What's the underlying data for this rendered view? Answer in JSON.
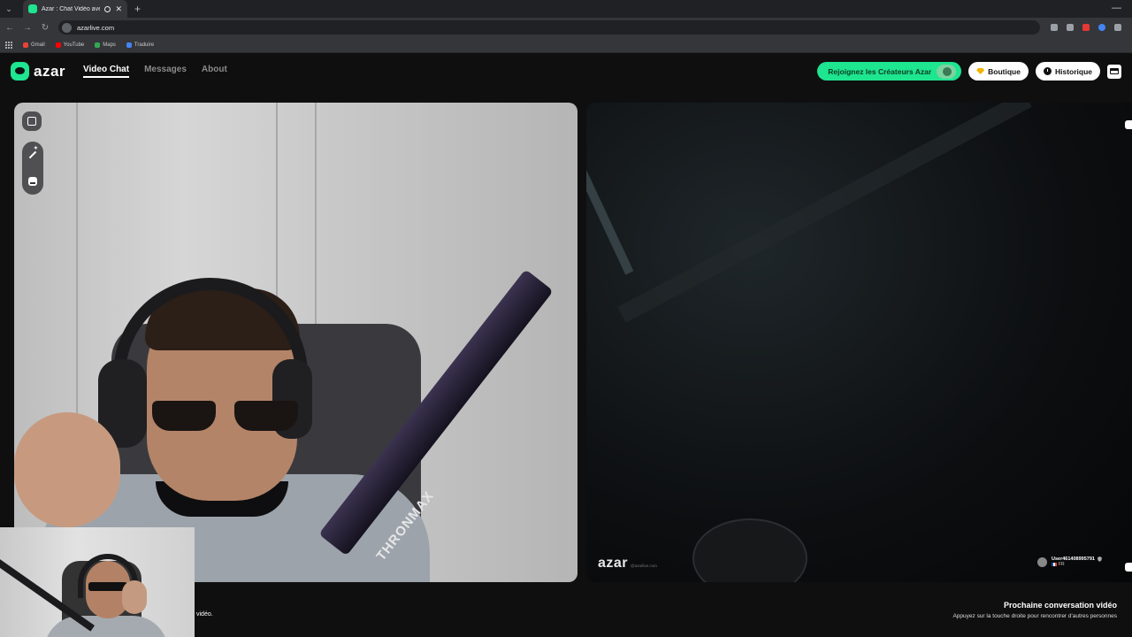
{
  "browser": {
    "tab_title": "Azar : Chat Vidéo avec de i",
    "tab_close": "✕",
    "new_tab": "+",
    "url": "azarlive.com",
    "bookmarks": [
      {
        "label": "Gmail",
        "color": "#ea4335"
      },
      {
        "label": "YouTube",
        "color": "#ff0000"
      },
      {
        "label": "Maps",
        "color": "#34a853"
      },
      {
        "label": "Traduire",
        "color": "#4285f4"
      }
    ]
  },
  "header": {
    "logo_text": "azar",
    "nav": [
      {
        "label": "Video Chat",
        "active": true
      },
      {
        "label": "Messages",
        "active": false
      },
      {
        "label": "About",
        "active": false
      }
    ],
    "creators_button": "Rejoignez les Créateurs Azar",
    "shop_button": "Boutique",
    "history_button": "Historique",
    "accent_color": "#1ee58f"
  },
  "remote_video": {
    "watermark": "azar",
    "watermark_sub": "@azarlive.com",
    "user_name": "User461408995791",
    "country": "FR"
  },
  "mic_label": "THRONMAX",
  "footer": {
    "left_text": "vidéo.",
    "next_title": "Prochaine conversation vidéo",
    "next_subtitle": "Appuyez sur la touche droite pour rencontrer d'autres personnes"
  }
}
